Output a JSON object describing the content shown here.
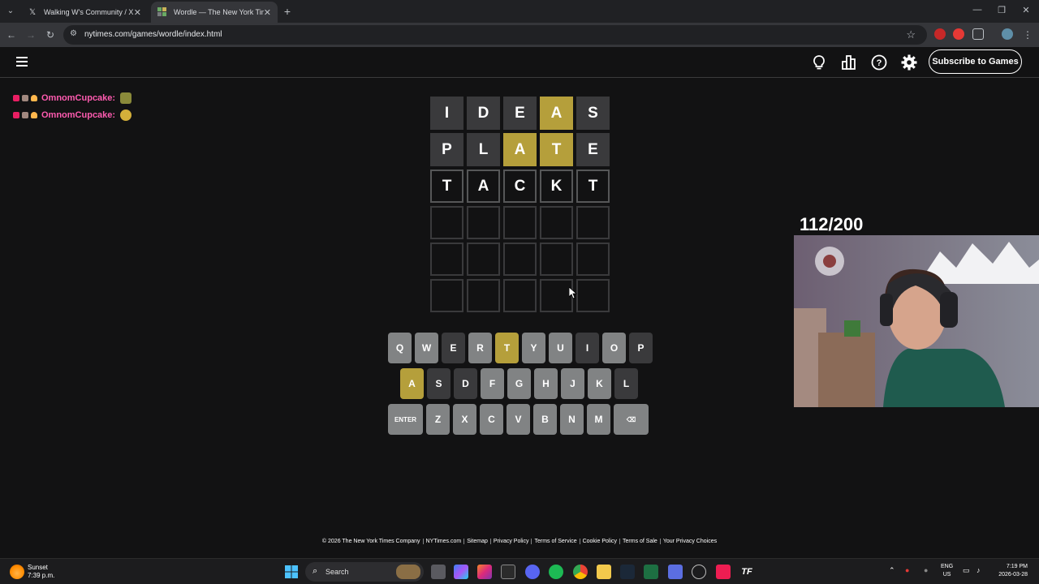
{
  "browser": {
    "tabs": [
      {
        "title": "Walking W's Community / X",
        "favicon": "x-logo-icon",
        "active": false
      },
      {
        "title": "Wordle — The New York Times",
        "favicon": "wordle-icon",
        "active": true
      }
    ],
    "url": "nytimes.com/games/wordle/index.html"
  },
  "header": {
    "subscribe_label": "Subscribe to Games",
    "icons": [
      "hint-bulb-icon",
      "stats-icon",
      "help-icon",
      "settings-icon"
    ]
  },
  "chat": [
    {
      "user": "OmnomCupcake:",
      "emote": "trophy-emote"
    },
    {
      "user": "OmnomCupcake:",
      "emote": "smile-emote"
    }
  ],
  "board": {
    "rows": [
      [
        {
          "l": "I",
          "s": "absent"
        },
        {
          "l": "D",
          "s": "absent"
        },
        {
          "l": "E",
          "s": "absent"
        },
        {
          "l": "A",
          "s": "present"
        },
        {
          "l": "S",
          "s": "absent"
        }
      ],
      [
        {
          "l": "P",
          "s": "absent"
        },
        {
          "l": "L",
          "s": "absent"
        },
        {
          "l": "A",
          "s": "present"
        },
        {
          "l": "T",
          "s": "present"
        },
        {
          "l": "E",
          "s": "absent"
        }
      ],
      [
        {
          "l": "T",
          "s": "tbd"
        },
        {
          "l": "A",
          "s": "tbd"
        },
        {
          "l": "C",
          "s": "tbd"
        },
        {
          "l": "K",
          "s": "tbd"
        },
        {
          "l": "T",
          "s": "tbd"
        }
      ],
      [
        {
          "l": "",
          "s": "empty"
        },
        {
          "l": "",
          "s": "empty"
        },
        {
          "l": "",
          "s": "empty"
        },
        {
          "l": "",
          "s": "empty"
        },
        {
          "l": "",
          "s": "empty"
        }
      ],
      [
        {
          "l": "",
          "s": "empty"
        },
        {
          "l": "",
          "s": "empty"
        },
        {
          "l": "",
          "s": "empty"
        },
        {
          "l": "",
          "s": "empty"
        },
        {
          "l": "",
          "s": "empty"
        }
      ],
      [
        {
          "l": "",
          "s": "empty"
        },
        {
          "l": "",
          "s": "empty"
        },
        {
          "l": "",
          "s": "empty"
        },
        {
          "l": "",
          "s": "empty"
        },
        {
          "l": "",
          "s": "empty"
        }
      ]
    ]
  },
  "keyboard": {
    "rows": [
      [
        {
          "k": "Q",
          "s": "unused"
        },
        {
          "k": "W",
          "s": "unused"
        },
        {
          "k": "E",
          "s": "absent"
        },
        {
          "k": "R",
          "s": "unused"
        },
        {
          "k": "T",
          "s": "present"
        },
        {
          "k": "Y",
          "s": "unused"
        },
        {
          "k": "U",
          "s": "unused"
        },
        {
          "k": "I",
          "s": "absent"
        },
        {
          "k": "O",
          "s": "unused"
        },
        {
          "k": "P",
          "s": "absent"
        }
      ],
      [
        {
          "k": "A",
          "s": "present"
        },
        {
          "k": "S",
          "s": "absent"
        },
        {
          "k": "D",
          "s": "absent"
        },
        {
          "k": "F",
          "s": "unused"
        },
        {
          "k": "G",
          "s": "unused"
        },
        {
          "k": "H",
          "s": "unused"
        },
        {
          "k": "J",
          "s": "unused"
        },
        {
          "k": "K",
          "s": "unused"
        },
        {
          "k": "L",
          "s": "absent"
        }
      ],
      [
        {
          "k": "ENTER",
          "s": "unused",
          "wide": true
        },
        {
          "k": "Z",
          "s": "unused"
        },
        {
          "k": "X",
          "s": "unused"
        },
        {
          "k": "C",
          "s": "unused"
        },
        {
          "k": "V",
          "s": "unused"
        },
        {
          "k": "B",
          "s": "unused"
        },
        {
          "k": "N",
          "s": "unused"
        },
        {
          "k": "M",
          "s": "unused"
        },
        {
          "k": "⌫",
          "s": "unused",
          "wide": true
        }
      ]
    ]
  },
  "stream_counter": "112/200",
  "footer": [
    "© 2026 The New York Times Company",
    "NYTimes.com",
    "Sitemap",
    "Privacy Policy",
    "Terms of Service",
    "Cookie Policy",
    "Terms of Sale",
    "Your Privacy Choices"
  ],
  "taskbar": {
    "weather_title": "Sunset",
    "weather_time": "7:39 p.m.",
    "search_placeholder": "Search",
    "lang_line1": "ENG",
    "lang_line2": "US",
    "time": "7:19 PM",
    "date": "2026-03-28"
  },
  "colors": {
    "background": "#121213",
    "present": "#b59f3b",
    "absent": "#3a3a3c",
    "key_unused": "#818384",
    "chat_user": "#ff5bb0"
  }
}
